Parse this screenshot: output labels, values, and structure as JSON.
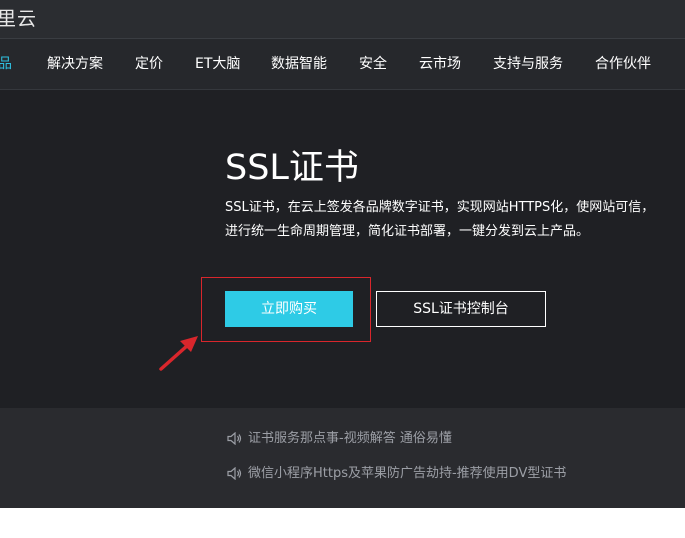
{
  "header": {
    "brand": "里云"
  },
  "nav": {
    "items": [
      {
        "label": "品",
        "active": true
      },
      {
        "label": "解决方案"
      },
      {
        "label": "定价"
      },
      {
        "label": "ET大脑"
      },
      {
        "label": "数据智能"
      },
      {
        "label": "安全"
      },
      {
        "label": "云市场"
      },
      {
        "label": "支持与服务"
      },
      {
        "label": "合作伙伴"
      }
    ]
  },
  "hero": {
    "title": "SSL证书",
    "desc_line1": "SSL证书，在云上签发各品牌数字证书，实现网站HTTPS化，使网站可信，",
    "desc_line2": "进行统一生命周期管理，简化证书部署，一键分发到云上产品。",
    "buy_label": "立即购买",
    "console_label": "SSL证书控制台"
  },
  "news": {
    "items": [
      {
        "text": "证书服务那点事-视频解答 通俗易懂"
      },
      {
        "text": "微信小程序Https及苹果防广告劫持-推荐使用DV型证书"
      }
    ]
  },
  "colors": {
    "accent": "#2ecbe6",
    "annotation_red": "#d9262c"
  }
}
